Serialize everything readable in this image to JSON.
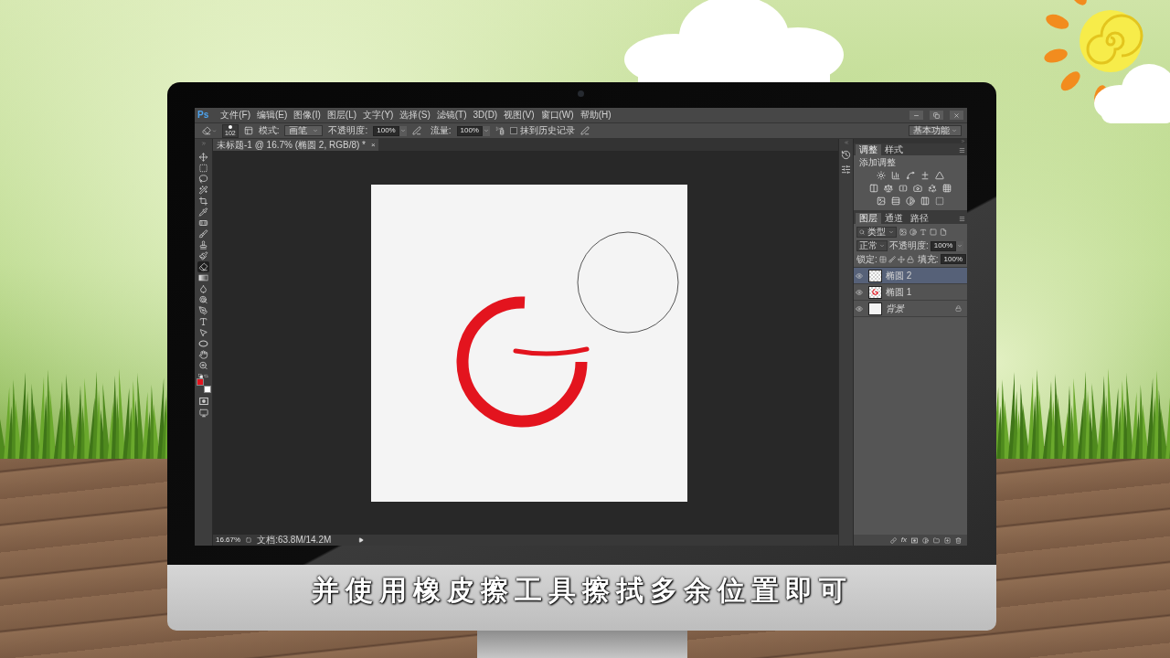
{
  "photoshop": {
    "menu_bar": {
      "logo": "Ps",
      "items": [
        "文件(F)",
        "编辑(E)",
        "图像(I)",
        "图层(L)",
        "文字(Y)",
        "选择(S)",
        "滤镜(T)",
        "3D(D)",
        "视图(V)",
        "窗口(W)",
        "帮助(H)"
      ]
    },
    "options_bar": {
      "brush_size": "102",
      "mode_label": "模式:",
      "mode": "画笔",
      "opacity_label": "不透明度:",
      "opacity": "100%",
      "flow_label": "流量:",
      "flow": "100%",
      "erase_to_history": {
        "label": "抹到历史记录",
        "checked": false
      },
      "workspace": "基本功能"
    },
    "document_tab": {
      "title": "未标题-1 @ 16.7% (椭圆 2, RGB/8) *",
      "close": "×"
    },
    "tools": [
      {
        "kind": "move",
        "selected": false
      },
      {
        "kind": "marquee",
        "selected": false
      },
      {
        "kind": "lasso",
        "selected": false
      },
      {
        "kind": "magic_wand",
        "selected": false
      },
      {
        "kind": "crop",
        "selected": false
      },
      {
        "kind": "eyedropper",
        "selected": false
      },
      {
        "kind": "healing",
        "selected": false
      },
      {
        "kind": "brush",
        "selected": false
      },
      {
        "kind": "stamp",
        "selected": false
      },
      {
        "kind": "history_brush",
        "selected": false
      },
      {
        "kind": "eraser",
        "selected": true
      },
      {
        "kind": "gradient",
        "selected": false
      },
      {
        "kind": "blur",
        "selected": false
      },
      {
        "kind": "dodge",
        "selected": false
      },
      {
        "kind": "pen",
        "selected": false
      },
      {
        "kind": "type",
        "selected": false
      },
      {
        "kind": "path_select",
        "selected": false
      },
      {
        "kind": "ellipse",
        "selected": false
      },
      {
        "kind": "hand",
        "selected": false
      },
      {
        "kind": "zoom",
        "selected": false
      }
    ],
    "color_swatches": [
      {
        "kind": "foreground",
        "color": "#e3141e"
      },
      {
        "kind": "background",
        "color": "#ffffff"
      }
    ],
    "status_bar": {
      "zoom": "16.67%",
      "document_size": "文档:63.8M/14.2M"
    },
    "adjustments_panel": {
      "tabs": [
        {
          "label": "调整",
          "selected": true
        },
        {
          "label": "样式",
          "selected": false
        }
      ],
      "heading": "添加调整"
    },
    "layers_panel": {
      "tabs": [
        {
          "label": "图层",
          "selected": true
        },
        {
          "label": "通道",
          "selected": false
        },
        {
          "label": "路径",
          "selected": false
        }
      ],
      "filter": "类型",
      "blend_mode": "正常",
      "opacity_label": "不透明度:",
      "opacity": "100%",
      "lock_label": "锁定:",
      "fill_label": "填充:",
      "fill": "100%",
      "layers": [
        {
          "name": "椭圆 2",
          "kind": "ellipse_empty",
          "selected": true,
          "visible": true,
          "locked": false
        },
        {
          "name": "椭圆 1",
          "kind": "ellipse_stroke",
          "selected": false,
          "visible": true,
          "locked": false
        },
        {
          "name": "背景",
          "kind": "background",
          "selected": false,
          "visible": true,
          "locked": true
        }
      ],
      "style_button": "fx"
    }
  },
  "subtitle": "并使用橡皮擦工具擦拭多余位置即可"
}
